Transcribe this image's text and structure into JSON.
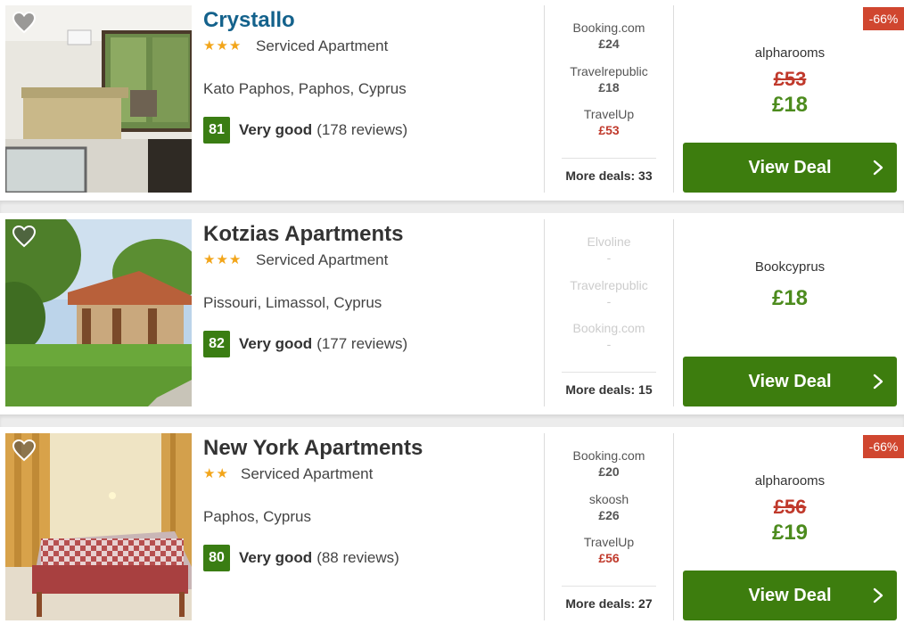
{
  "hotels": [
    {
      "name": "Crystallo",
      "stars": "★★★",
      "property_type": "Serviced Apartment",
      "location": "Kato Paphos, Paphos, Cyprus",
      "score": "81",
      "rating_label": "Very good",
      "reviews": "(178 reviews)",
      "deals": [
        {
          "name": "Booking.com",
          "price": "£24"
        },
        {
          "name": "Travelrepublic",
          "price": "£18"
        },
        {
          "name": "TravelUp",
          "price": "£53"
        }
      ],
      "more_deals": "More deals: 33",
      "discount": "-66%",
      "provider": "alpharooms",
      "old_price": "£53",
      "price": "£18",
      "button_label": "View Deal"
    },
    {
      "name": "Kotzias Apartments",
      "stars": "★★★",
      "property_type": "Serviced Apartment",
      "location": "Pissouri, Limassol, Cyprus",
      "score": "82",
      "rating_label": "Very good",
      "reviews": "(177 reviews)",
      "deals": [
        {
          "name": "Elvoline",
          "price": "-"
        },
        {
          "name": "Travelrepublic",
          "price": "-"
        },
        {
          "name": "Booking.com",
          "price": "-"
        }
      ],
      "more_deals": "More deals: 15",
      "provider": "Bookcyprus",
      "price": "£18",
      "button_label": "View Deal"
    },
    {
      "name": "New York Apartments",
      "stars": "★★",
      "property_type": "Serviced Apartment",
      "location": "Paphos, Cyprus",
      "score": "80",
      "rating_label": "Very good",
      "reviews": "(88 reviews)",
      "deals": [
        {
          "name": "Booking.com",
          "price": "£20"
        },
        {
          "name": "skoosh",
          "price": "£26"
        },
        {
          "name": "TravelUp",
          "price": "£56"
        }
      ],
      "more_deals": "More deals: 27",
      "discount": "-66%",
      "provider": "alpharooms",
      "old_price": "£56",
      "price": "£19",
      "button_label": "View Deal"
    }
  ],
  "colors": {
    "title_link": "#14628c",
    "score_green": "#3a7d13",
    "price_green": "#4c8b1d",
    "button_green": "#3d7d0e",
    "discount_red": "#d0462f",
    "star_gold": "#f2a51a"
  },
  "icons": [
    "heart-icon",
    "chevron-right-icon",
    "star-icon"
  ]
}
